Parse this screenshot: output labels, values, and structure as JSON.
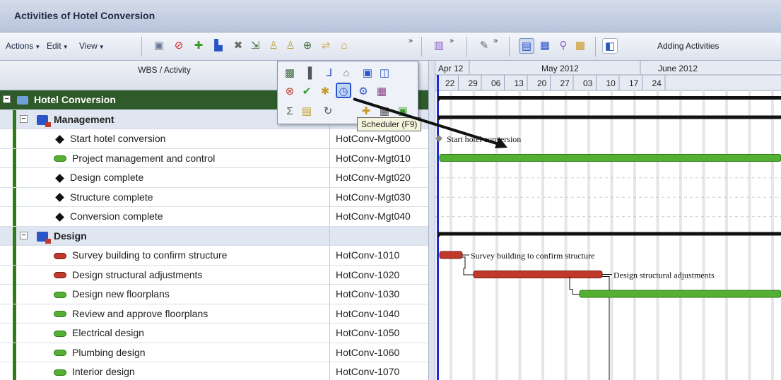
{
  "window": {
    "title": "Activities of Hotel Conversion"
  },
  "toolbar": {
    "menus": [
      "Actions",
      "Edit",
      "View"
    ],
    "status_label": "Adding Activities"
  },
  "columns": {
    "wbs": "WBS / Activity",
    "id": ""
  },
  "timeline": {
    "months": [
      "Apr 12",
      "May 2012",
      "June 2012"
    ],
    "weeks": [
      "22",
      "29",
      "06",
      "13",
      "20",
      "27",
      "03",
      "10",
      "17",
      "24"
    ]
  },
  "popup": {
    "tooltip": "Scheduler (F9)"
  },
  "rows": [
    {
      "type": "project",
      "name": "Hotel Conversion",
      "id": ""
    },
    {
      "type": "wbs",
      "name": "Management",
      "id": ""
    },
    {
      "type": "milestone",
      "name": "Start hotel conversion",
      "id": "HotConv-Mgt000"
    },
    {
      "type": "activity",
      "status": "green",
      "name": "Project management and control",
      "id": "HotConv-Mgt010"
    },
    {
      "type": "milestone",
      "name": "Design complete",
      "id": "HotConv-Mgt020"
    },
    {
      "type": "milestone",
      "name": "Structure complete",
      "id": "HotConv-Mgt030"
    },
    {
      "type": "milestone",
      "name": "Conversion complete",
      "id": "HotConv-Mgt040"
    },
    {
      "type": "wbs",
      "name": "Design",
      "id": ""
    },
    {
      "type": "activity",
      "status": "red",
      "name": "Survey building to confirm structure",
      "id": "HotConv-1010"
    },
    {
      "type": "activity",
      "status": "red",
      "name": "Design structural adjustments",
      "id": "HotConv-1020"
    },
    {
      "type": "activity",
      "status": "green",
      "name": "Design new floorplans",
      "id": "HotConv-1030"
    },
    {
      "type": "activity",
      "status": "green",
      "name": "Review and approve floorplans",
      "id": "HotConv-1040"
    },
    {
      "type": "activity",
      "status": "green",
      "name": "Electrical design",
      "id": "HotConv-1050"
    },
    {
      "type": "activity",
      "status": "green",
      "name": "Plumbing design",
      "id": "HotConv-1060"
    },
    {
      "type": "activity",
      "status": "green",
      "name": "Interior design",
      "id": "HotConv-1070"
    }
  ],
  "gantt_labels": {
    "start": "Start hotel conversion",
    "survey": "Survey building to confirm structure",
    "design_struct": "Design structural adjustments"
  },
  "colors": {
    "green_bar": "#53b032",
    "red_bar": "#c0392b",
    "data_date": "#1e2bd6"
  }
}
